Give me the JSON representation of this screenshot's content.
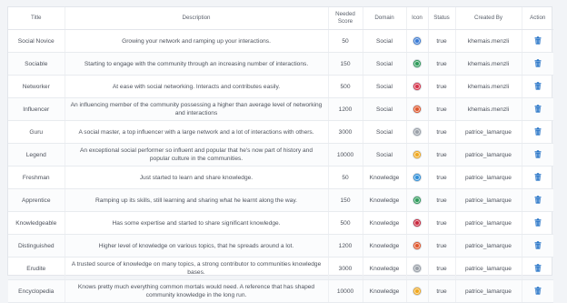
{
  "headers": {
    "title": "Title",
    "description": "Description",
    "needed_score": "Needed Score",
    "domain": "Domain",
    "icon": "Icon",
    "status": "Status",
    "created_by": "Created By",
    "action": "Action"
  },
  "rows": [
    {
      "title": "Social Novice",
      "description": "Growing your network and ramping up your interactions.",
      "score": "50",
      "domain": "Social",
      "icon_color": "#3a7bd5",
      "status": "true",
      "created_by": "khemais.menzli"
    },
    {
      "title": "Sociable",
      "description": "Starting to engage with the community through an increasing number of interactions.",
      "score": "150",
      "domain": "Social",
      "icon_color": "#2e9b5a",
      "status": "true",
      "created_by": "khemais.menzli"
    },
    {
      "title": "Networker",
      "description": "At ease with social networking. Interacts and contributes easily.",
      "score": "500",
      "domain": "Social",
      "icon_color": "#d6334a",
      "status": "true",
      "created_by": "khemais.menzli"
    },
    {
      "title": "Influencer",
      "description": "An influencing member of the community possessing a higher than average level of networking and interactions",
      "score": "1200",
      "domain": "Social",
      "icon_color": "#e0562b",
      "status": "true",
      "created_by": "khemais.menzli"
    },
    {
      "title": "Guru",
      "description": "A social master, a top influencer with a large network and a lot of interactions with others.",
      "score": "3000",
      "domain": "Social",
      "icon_color": "#9aa0a8",
      "status": "true",
      "created_by": "patrice_lamarque"
    },
    {
      "title": "Legend",
      "description": "An exceptional social performer so influent and popular that he's now part of history and popular culture in the communities.",
      "score": "10000",
      "domain": "Social",
      "icon_color": "#f0a81e",
      "status": "true",
      "created_by": "patrice_lamarque"
    },
    {
      "title": "Freshman",
      "description": "Just started to learn and share knowledge.",
      "score": "50",
      "domain": "Knowledge",
      "icon_color": "#2f8fd8",
      "status": "true",
      "created_by": "patrice_lamarque"
    },
    {
      "title": "Apprentice",
      "description": "Ramping up its skills, still learning and sharing what he learnt along the way.",
      "score": "150",
      "domain": "Knowledge",
      "icon_color": "#2e9b5a",
      "status": "true",
      "created_by": "patrice_lamarque"
    },
    {
      "title": "Knowledgeable",
      "description": "Has some expertise and started to share significant knowledge.",
      "score": "500",
      "domain": "Knowledge",
      "icon_color": "#c9283e",
      "status": "true",
      "created_by": "patrice_lamarque"
    },
    {
      "title": "Distinguished",
      "description": "Higher level of knowledge on various topics, that he spreads around a lot.",
      "score": "1200",
      "domain": "Knowledge",
      "icon_color": "#e0562b",
      "status": "true",
      "created_by": "patrice_lamarque"
    },
    {
      "title": "Erudite",
      "description": "A trusted source of knowledge on many topics, a strong contributor to communities knowledge bases.",
      "score": "3000",
      "domain": "Knowledge",
      "icon_color": "#9aa0a8",
      "status": "true",
      "created_by": "patrice_lamarque"
    },
    {
      "title": "Encyclopedia",
      "description": "Knows pretty much everything common mortals would need. A reference that has shaped community knowledge in the long run.",
      "score": "10000",
      "domain": "Knowledge",
      "icon_color": "#f0a81e",
      "status": "true",
      "created_by": "patrice_lamarque"
    }
  ],
  "action_icon": "trash-icon",
  "action_color": "#1f6fc5"
}
